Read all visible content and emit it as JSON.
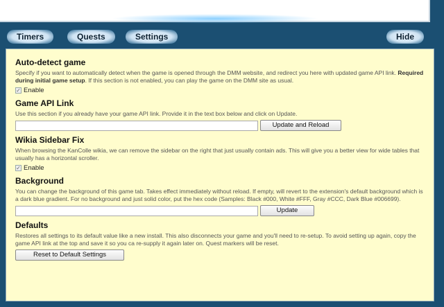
{
  "nav": {
    "timers": "Timers",
    "quests": "Quests",
    "settings": "Settings",
    "hide": "Hide"
  },
  "sections": {
    "autodetect": {
      "title": "Auto-detect game",
      "desc_main": "Specify if you want to automatically detect when the game is opened through the DMM website, and redirect you here with updated game API link. ",
      "desc_bold": "Required during initial game setup",
      "desc_tail": ". If this section is not enabled, you can play the game on the DMM site as usual.",
      "checkbox_label": "Enable",
      "checked": true
    },
    "api_link": {
      "title": "Game API Link",
      "desc": "Use this section if you already have your game API link. Provide it in the text box below and click on Update.",
      "input_value": "",
      "button": "Update and Reload"
    },
    "wikia": {
      "title": "Wikia Sidebar Fix",
      "desc": "When browsing the KanColle wikia, we can remove the sidebar on the right that just usually contain ads. This will give you a better view for wide tables that usually has a horizontal scroller.",
      "checkbox_label": "Enable",
      "checked": true
    },
    "background": {
      "title": "Background",
      "desc": "You can change the background of this game tab. Takes effect immediately without reload. If empty, will revert to the extension's default background which is a dark blue gradient. For no background and just solid color, put the hex code (Samples: Black #000, White #FFF, Gray #CCC, Dark Blue #006699).",
      "input_value": "",
      "button": "Update"
    },
    "defaults": {
      "title": "Defaults",
      "desc": "Restores all settings to its default value like a new install. This also disconnects your game and you'll need to re-setup. To avoid setting up again, copy the game API link at the top and save it so you ca re-supply it again later on. Quest markers will be reset.",
      "button": "Reset to Default Settings"
    }
  },
  "colors": {
    "page_bg": "#1b4f72",
    "panel_bg": "#fffdcd"
  }
}
